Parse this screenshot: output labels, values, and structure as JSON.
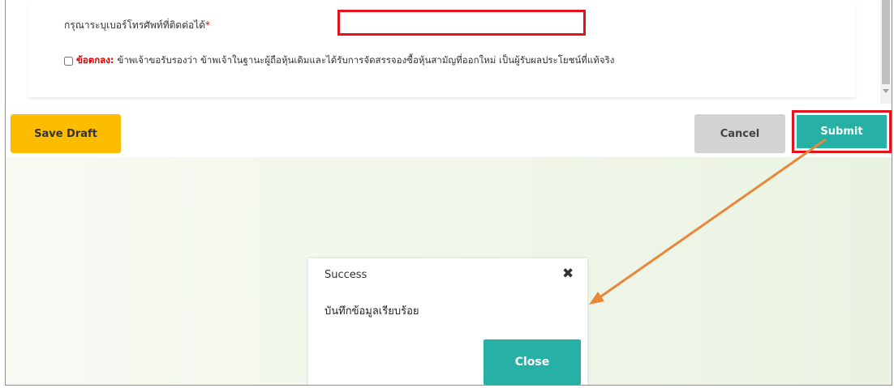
{
  "form": {
    "phone_label": "กรุณาระบุเบอร์โทรศัพท์ที่ติดต่อได้",
    "required_mark": "*",
    "phone_value": "",
    "agreement_key": "ข้อตกลง:",
    "agreement_text": "ข้าพเจ้าขอรับรองว่า ข้าพเจ้าในฐานะผู้ถือหุ้นเดิมและได้รับการจัดสรรจองซื้อหุ้นสามัญที่ออกใหม่ เป็นผู้รับผลประโยชน์ที่แท้จริง"
  },
  "actions": {
    "save_draft": "Save Draft",
    "cancel": "Cancel",
    "submit": "Submit"
  },
  "modal": {
    "title": "Success",
    "message": "บันทึกข้อมูลเรียบร้อย",
    "close": "Close"
  },
  "colors": {
    "highlight": "#e3131c",
    "arrow": "#e8873a",
    "teal": "#27b0a6",
    "yellow": "#fcbd00"
  }
}
